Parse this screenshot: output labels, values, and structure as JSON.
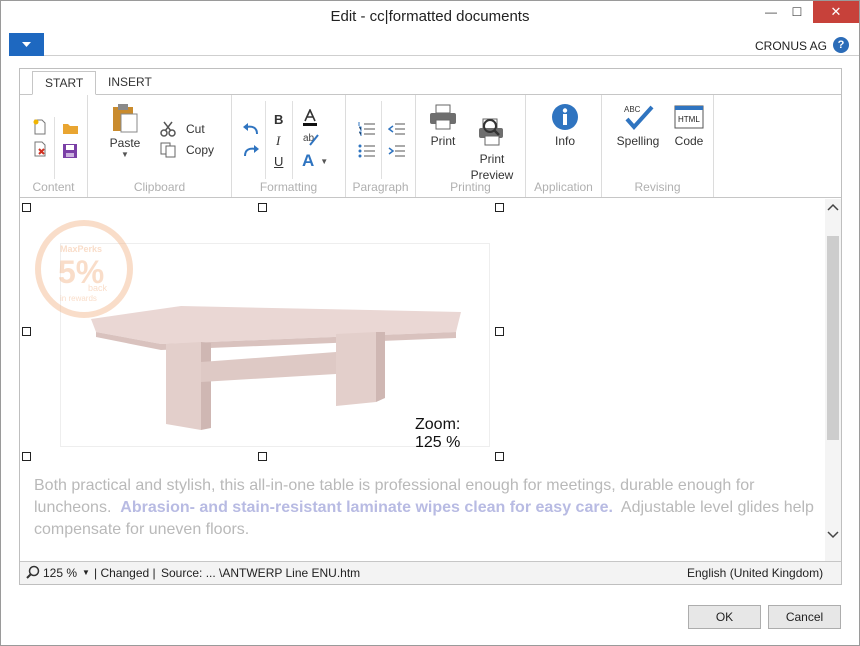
{
  "window": {
    "title": "Edit - cc|formatted documents",
    "minimize_glyph": "—",
    "maximize_glyph": "☐",
    "close_glyph": "✕"
  },
  "app": {
    "company": "CRONUS AG",
    "help_glyph": "?"
  },
  "ribbon": {
    "tabs": [
      {
        "label": "START",
        "active": true
      },
      {
        "label": "INSERT",
        "active": false
      }
    ],
    "groups": {
      "content": "Content",
      "clipboard": "Clipboard",
      "formatting": "Formatting",
      "paragraph": "Paragraph",
      "printing": "Printing",
      "application": "Application",
      "revising": "Revising"
    },
    "buttons": {
      "paste": "Paste",
      "cut": "Cut",
      "copy": "Copy",
      "bold": "B",
      "italic": "I",
      "underline": "U",
      "font_color_letter": "A",
      "print": "Print",
      "print_preview": "Print\nPreview",
      "info": "Info",
      "spelling": "Spelling",
      "code": "Code",
      "spelling_icon_text": "ABC",
      "code_icon_text": "HTML"
    }
  },
  "document": {
    "badge_line1": "MaxPerks",
    "badge_pct": "5%",
    "badge_line2": "back",
    "badge_line3": "in rewards",
    "zoom_overlay": "Zoom: 125 %",
    "paragraph_before": "Both practical and stylish, this all-in-one table is professional enough for meetings, durable enough for luncheons.",
    "paragraph_bold": "Abrasion- and stain-resistant laminate wipes clean for easy care.",
    "paragraph_after": "Adjustable level glides help compensate for uneven floors."
  },
  "status": {
    "zoom": "125 %",
    "changed": "| Changed |",
    "source": "Source: ... \\ANTWERP Line ENU.htm",
    "language": "English (United Kingdom)"
  },
  "dialog": {
    "ok": "OK",
    "cancel": "Cancel"
  },
  "colors": {
    "accent": "#1e68c0",
    "close": "#c7413a",
    "icon_blue": "#2f74c0"
  }
}
